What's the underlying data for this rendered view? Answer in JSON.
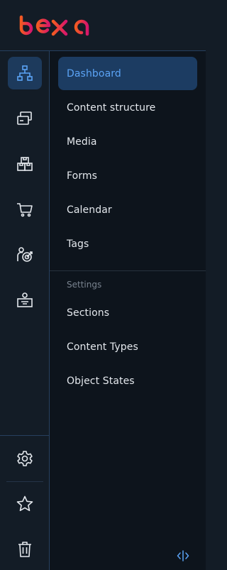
{
  "brand": {
    "logo_text": "ibexa",
    "accent": "#5ba3f5"
  },
  "rail": {
    "items": [
      {
        "icon": "sitemap-icon",
        "name": "rail-content",
        "active": true
      },
      {
        "icon": "content-cards-icon",
        "name": "rail-content-types",
        "active": false
      },
      {
        "icon": "products-icon",
        "name": "rail-products",
        "active": false
      },
      {
        "icon": "cart-icon",
        "name": "rail-commerce",
        "active": false
      },
      {
        "icon": "customer-target-icon",
        "name": "rail-customers",
        "active": false
      },
      {
        "icon": "admin-desk-icon",
        "name": "rail-admin",
        "active": false
      }
    ],
    "bottom": [
      {
        "icon": "gear-icon",
        "name": "settings-button"
      },
      {
        "icon": "star-icon",
        "name": "bookmarks-button"
      },
      {
        "icon": "trash-icon",
        "name": "trash-button"
      }
    ]
  },
  "panel": {
    "items": [
      {
        "label": "Dashboard",
        "active": true
      },
      {
        "label": "Content structure",
        "active": false
      },
      {
        "label": "Media",
        "active": false
      },
      {
        "label": "Forms",
        "active": false
      },
      {
        "label": "Calendar",
        "active": false
      },
      {
        "label": "Tags",
        "active": false
      }
    ],
    "settings_label": "Settings",
    "settings_items": [
      {
        "label": "Sections"
      },
      {
        "label": "Content Types"
      },
      {
        "label": "Object States"
      }
    ],
    "collapse_icon": "collapse-panel-icon"
  }
}
